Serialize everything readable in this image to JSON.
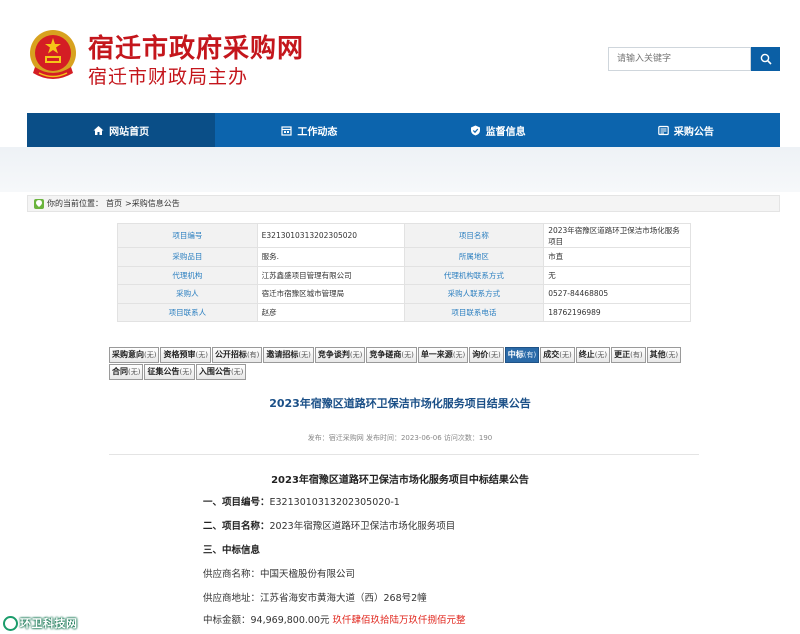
{
  "header": {
    "site_title": "宿迁市政府采购网",
    "site_subtitle": "宿迁市财政局主办",
    "search_placeholder": "请输入关键字"
  },
  "nav": [
    {
      "label": "网站首页",
      "icon": "home-icon",
      "active": true
    },
    {
      "label": "工作动态",
      "icon": "calendar-icon",
      "active": false
    },
    {
      "label": "监督信息",
      "icon": "shield-check-icon",
      "active": false
    },
    {
      "label": "采购公告",
      "icon": "announcement-icon",
      "active": false
    }
  ],
  "breadcrumb": {
    "prefix": "你的当前位置：",
    "home": "首页",
    "current": ">采购信息公告"
  },
  "info_table": [
    {
      "l1": "项目编号",
      "v1": "E3213010313202305020",
      "l2": "项目名称",
      "v2": "2023年宿豫区道路环卫保洁市场化服务项目"
    },
    {
      "l1": "采购品目",
      "v1": "服务.",
      "l2": "所属地区",
      "v2": "市直"
    },
    {
      "l1": "代理机构",
      "v1": "江苏鑫盛项目管理有限公司",
      "l2": "代理机构联系方式",
      "v2": "无"
    },
    {
      "l1": "采购人",
      "v1": "宿迁市宿豫区城市管理局",
      "l2": "采购人联系方式",
      "v2": "0527-84468805"
    },
    {
      "l1": "项目联系人",
      "v1": "赵彦",
      "l2": "项目联系电话",
      "v2": "18762196989"
    }
  ],
  "tabs": [
    {
      "label": "采购意向",
      "count": "(无)",
      "active": false
    },
    {
      "label": "资格预审",
      "count": "(无)",
      "active": false
    },
    {
      "label": "公开招标",
      "count": "(有)",
      "active": false
    },
    {
      "label": "邀请招标",
      "count": "(无)",
      "active": false
    },
    {
      "label": "竞争谈判",
      "count": "(无)",
      "active": false
    },
    {
      "label": "竞争磋商",
      "count": "(无)",
      "active": false
    },
    {
      "label": "单一来源",
      "count": "(无)",
      "active": false
    },
    {
      "label": "询价",
      "count": "(无)",
      "active": false
    },
    {
      "label": "中标",
      "count": "(有)",
      "active": true
    },
    {
      "label": "成交",
      "count": "(无)",
      "active": false
    },
    {
      "label": "终止",
      "count": "(无)",
      "active": false
    },
    {
      "label": "更正",
      "count": "(有)",
      "active": false
    },
    {
      "label": "其他",
      "count": "(无)",
      "active": false
    },
    {
      "label": "合同",
      "count": "(无)",
      "active": false
    },
    {
      "label": "征集公告",
      "count": "(无)",
      "active": false
    },
    {
      "label": "入围公告",
      "count": "(无)",
      "active": false
    }
  ],
  "article": {
    "title": "2023年宿豫区道路环卫保洁市场化服务项目结果公告",
    "meta": "发布：宿迁采购网  发布时间：2023-06-06  访问次数：190",
    "doc_title": "2023年宿豫区道路环卫保洁市场化服务项目中标结果公告",
    "item1_label": "一、项目编号：",
    "item1_value": "E3213010313202305020-1",
    "item2_label": "二、项目名称：",
    "item2_value": "2023年宿豫区道路环卫保洁市场化服务项目",
    "item3_label": "三、中标信息",
    "supplier_name": "供应商名称：中国天楹股份有限公司",
    "supplier_addr": "供应商地址：江苏省海安市黄海大道（西）268号2幢",
    "amount_label": "中标金额：94,969,800.00元",
    "amount_words": "玖仟肆佰玖拾陆万玖仟捌佰元整"
  },
  "watermark": {
    "text": "环卫科技网"
  },
  "colors": {
    "brand_red": "#c4161c",
    "nav_blue": "#0c64ad",
    "nav_active": "#0a4e87",
    "label_blue": "#2b7fc0",
    "title_blue": "#1a4f87",
    "amount_red": "#e0241b"
  }
}
